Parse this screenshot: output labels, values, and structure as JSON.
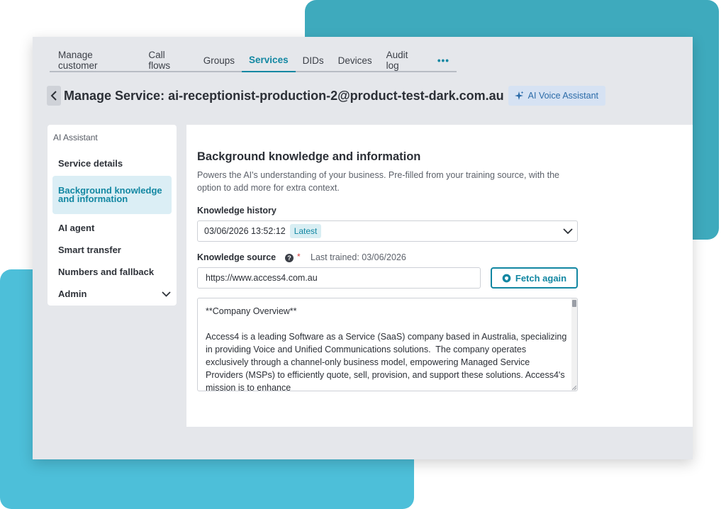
{
  "tabs": [
    {
      "label": "Manage customer"
    },
    {
      "label": "Call flows"
    },
    {
      "label": "Groups"
    },
    {
      "label": "Services"
    },
    {
      "label": "DIDs"
    },
    {
      "label": "Devices"
    },
    {
      "label": "Audit log"
    },
    {
      "label": "•••"
    }
  ],
  "active_tab": "Services",
  "header": {
    "title": "Manage Service: ai-receptionist-production-2@product-test-dark.com.au",
    "badge": "AI Voice Assistant"
  },
  "sidebar": {
    "heading": "AI Assistant",
    "items": [
      {
        "label": "Service details"
      },
      {
        "label": "Background knowledge and information"
      },
      {
        "label": "AI agent"
      },
      {
        "label": "Smart transfer"
      },
      {
        "label": "Numbers and fallback"
      },
      {
        "label": "Admin"
      }
    ],
    "active_item": "Background knowledge and information"
  },
  "main": {
    "title": "Background knowledge and information",
    "description": "Powers the AI's understanding of your business. Pre-filled from your training source, with the option to add more for extra context.",
    "history_label": "Knowledge history",
    "history_value": "03/06/2026 13:52:12",
    "history_tag": "Latest",
    "source_label": "Knowledge source",
    "required_mark": "*",
    "last_trained": "Last trained: 03/06/2026",
    "source_url": "https://www.access4.com.au",
    "fetch_label": "Fetch again",
    "knowledge_text": "**Company Overview**\n\nAccess4 is a leading Software as a Service (SaaS) company based in Australia, specializing in providing Voice and Unified Communications solutions.  The company operates exclusively through a channel-only business model, empowering Managed Service Providers (MSPs) to efficiently quote, sell, provision, and support these solutions. Access4's mission is to enhance"
  },
  "colors": {
    "accent": "#1287a2",
    "blob_top": "#3eaabd",
    "blob_bottom": "#4dbfd9",
    "badge_bg": "#d6e2f3",
    "required": "#d23b3b"
  },
  "icons": {
    "back": "chevron-left-icon",
    "badge": "sparkle-icon",
    "dropdown": "chevron-down-icon",
    "help": "question-circle-icon",
    "fetch": "brain-icon"
  }
}
